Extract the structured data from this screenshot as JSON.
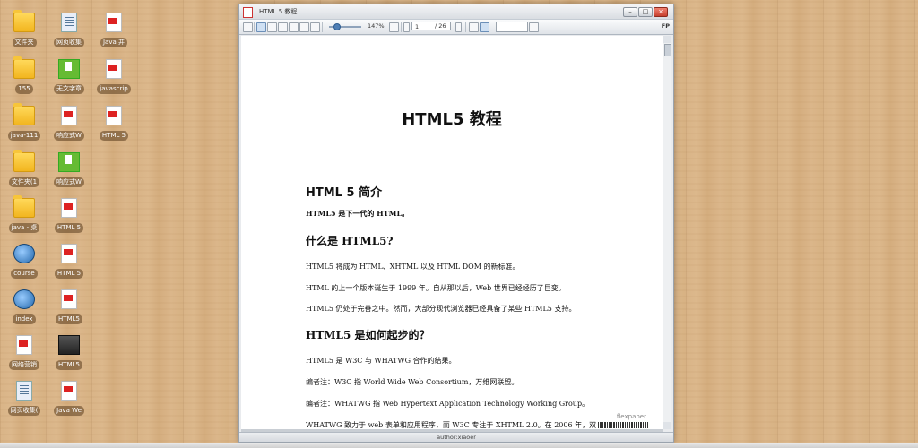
{
  "desktop": {
    "icons": [
      {
        "label": "文件夹",
        "type": "folder"
      },
      {
        "label": "网页收集",
        "type": "doc"
      },
      {
        "label": "Java 并",
        "type": "pdf"
      },
      {
        "label": "155",
        "type": "folder"
      },
      {
        "label": "无文字章",
        "type": "img"
      },
      {
        "label": "javascrip",
        "type": "pdf"
      },
      {
        "label": "java-111",
        "type": "folder"
      },
      {
        "label": "响应式W",
        "type": "pdf"
      },
      {
        "label": "HTML 5",
        "type": "pdf"
      },
      {
        "label": "文件夹(1",
        "type": "folder"
      },
      {
        "label": "响应式W",
        "type": "img"
      },
      {
        "label": "java - 桌",
        "type": "folder"
      },
      {
        "label": "HTML 5",
        "type": "pdf"
      },
      {
        "label": "course",
        "type": "ie"
      },
      {
        "label": "HTML 5",
        "type": "pdf"
      },
      {
        "label": "index",
        "type": "ie"
      },
      {
        "label": "HTML5",
        "type": "pdf"
      },
      {
        "label": "网络营销",
        "type": "pdf"
      },
      {
        "label": "HTML5",
        "type": "rar"
      },
      {
        "label": "网页收集(",
        "type": "doc"
      },
      {
        "label": "Java We",
        "type": "pdf"
      }
    ]
  },
  "window": {
    "title": "HTML 5 教程",
    "minimize_label": "–",
    "maximize_label": "□",
    "close_label": "×"
  },
  "toolbar": {
    "zoom": "147%",
    "page_current": "1",
    "page_total": "/ 26",
    "right_label": "FP"
  },
  "document": {
    "title": "HTML5 教程",
    "section1": "HTML 5  简介",
    "lead": "HTML5  是下一代的  HTML。",
    "q1": "什么是  HTML5?",
    "p1": "HTML5  将成为  HTML、XHTML  以及  HTML DOM  的新标准。",
    "p2": "HTML  的上一个版本诞生于  1999  年。自从那以后，Web  世界已经经历了巨变。",
    "p3": "HTML5  仍处于完善之中。然而，大部分现代浏览器已经具备了某些  HTML5  支持。",
    "q2": "HTML5  是如何起步的？",
    "p4": "HTML5  是  W3C  与  WHATWG  合作的结果。",
    "p5": "编者注：W3C  指  World Wide Web Consortium，万维网联盟。",
    "p6": "编者注：WHATWG  指  Web Hypertext Application Technology Working Group。",
    "p7": "WHATWG  致力于  web  表单和应用程序，而  W3C  专注于  XHTML 2.0。在  2006  年，双",
    "watermark": "flexpaper"
  },
  "statusbar": {
    "text": "author:xiaoer"
  }
}
